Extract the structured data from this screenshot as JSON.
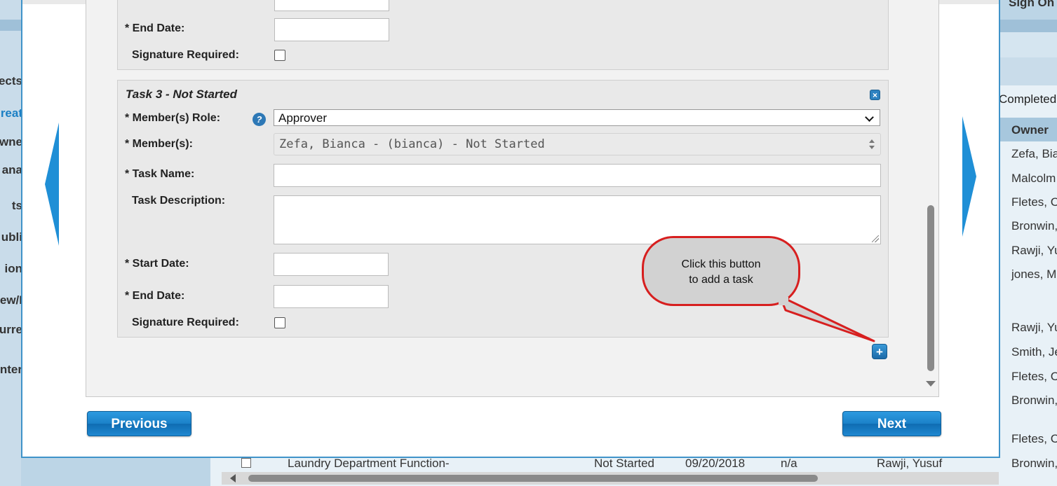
{
  "background": {
    "left_items": [
      "ects",
      "reat",
      "wne",
      "ana",
      "ts",
      "ubli",
      "ion",
      "ew/I",
      "urre",
      "nter"
    ],
    "right": {
      "sign_on": "Sign On",
      "completed": "Completed",
      "owner_header": "Owner",
      "owners": [
        "Zefa, Bia",
        "Malcolm",
        "Fletes, C",
        "Bronwin,",
        "Rawji, Yu",
        "jones, M",
        "Rawji, Yu",
        "Smith, Je",
        "Fletes, C",
        "Bronwin,",
        "Fletes, C",
        "Bronwin,"
      ]
    },
    "bottom_row": {
      "title": "Laundry Department Function-",
      "status": "Not Started",
      "date": "09/20/2018",
      "value": "n/a",
      "owner": "Rawji, Yusuf"
    }
  },
  "task2": {
    "end_date_label": "* End Date:",
    "end_date_value": "",
    "signature_label": "Signature Required:"
  },
  "task3": {
    "title": "Task 3 - Not Started",
    "role_label": "* Member(s) Role:",
    "role_value": "Approver",
    "members_label": "* Member(s):",
    "members_value": "Zefa, Bianca - (bianca) - Not Started",
    "task_name_label": "* Task Name:",
    "task_name_value": "",
    "description_label": "Task Description:",
    "description_value": "",
    "start_date_label": "* Start Date:",
    "start_date_value": "",
    "end_date_label": "* End Date:",
    "end_date_value": "",
    "signature_label": "Signature Required:"
  },
  "callout": {
    "line1": "Click this button",
    "line2": "to add a task"
  },
  "buttons": {
    "previous": "Previous",
    "next": "Next",
    "add_task_symbol": "+",
    "close_symbol": "×"
  },
  "colors": {
    "accent": "#1f8fd6",
    "callout_border": "#d71f1f",
    "panel_bg": "#e9e9e9"
  }
}
